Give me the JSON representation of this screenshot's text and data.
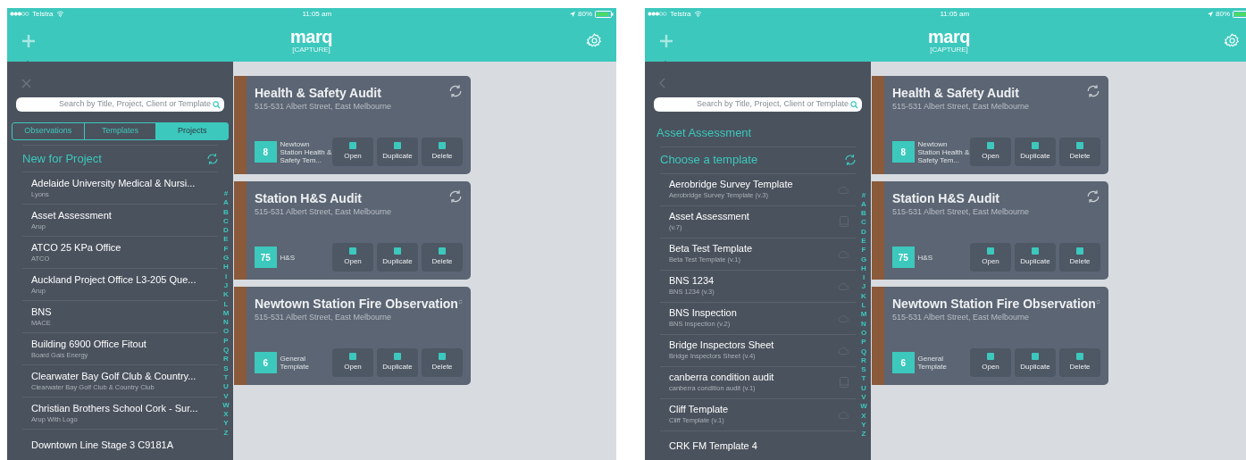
{
  "screens": [
    {
      "status_bar": {
        "carrier": "Telstra",
        "time": "11:05 am",
        "battery": "80%"
      },
      "header": {
        "logo": "marq",
        "logo_sub": "[CAPTURE]"
      },
      "panel": {
        "kind": "projects",
        "search": {
          "placeholder": "Search by Title, Project, Client or Template"
        },
        "tabs": [
          {
            "label": "Observations",
            "selected": false
          },
          {
            "label": "Templates",
            "selected": false
          },
          {
            "label": "Projects",
            "selected": true
          }
        ],
        "section": "New for Project",
        "items": [
          {
            "title": "Adelaide University Medical & Nursi...",
            "subtitle": "Lyons"
          },
          {
            "title": "Asset Assessment",
            "subtitle": "Arup"
          },
          {
            "title": "ATCO 25 KPa Office",
            "subtitle": "ATCO"
          },
          {
            "title": "Auckland Project Office L3-205 Que...",
            "subtitle": "Arup"
          },
          {
            "title": "BNS",
            "subtitle": "MACE"
          },
          {
            "title": "Building 6900 Office Fitout",
            "subtitle": "Board Gais Energy"
          },
          {
            "title": "Clearwater Bay Golf Club & Country...",
            "subtitle": "Clearwater Bay Golf Club & Country Club"
          },
          {
            "title": "Christian Brothers School Cork - Sur...",
            "subtitle": "Arup With Logo"
          },
          {
            "title": "Downtown Line Stage 3 C9181A"
          }
        ],
        "index": [
          "#",
          "A",
          "B",
          "C",
          "D",
          "E",
          "F",
          "G",
          "H",
          "I",
          "J",
          "K",
          "L",
          "M",
          "N",
          "O",
          "P",
          "Q",
          "R",
          "S",
          "T",
          "U",
          "V",
          "W",
          "X",
          "Y",
          "Z"
        ]
      },
      "cards": [
        {
          "title": "Health & Safety Audit",
          "address": "515-531 Albert Street, East Melbourne",
          "count": "8",
          "label": "Newtown Station Health & Safety Tem...",
          "buttons": [
            "Open",
            "Duplicate",
            "Delete"
          ]
        },
        {
          "title": "Station H&S Audit",
          "address": "515-531 Albert Street, East Melbourne",
          "count": "75",
          "label": "H&S",
          "buttons": [
            "Open",
            "Duplicate",
            "Delete"
          ]
        },
        {
          "title": "Newtown Station Fire Observation",
          "address": "515-531 Albert Street, East Melbourne",
          "count": "6",
          "label": "General Template",
          "buttons": [
            "Open",
            "Duplicate",
            "Delete"
          ]
        }
      ]
    },
    {
      "status_bar": {
        "carrier": "Telstra",
        "time": "11:05 am",
        "battery": "80%"
      },
      "header": {
        "logo": "marq",
        "logo_sub": "[CAPTURE]"
      },
      "panel": {
        "kind": "templates",
        "search": {
          "placeholder": "Search by Title, Project, Client or Template"
        },
        "breadcrumb": "Asset Assessment",
        "section": "Choose a template",
        "items": [
          {
            "title": "Aerobridge Survey Template",
            "subtitle": "Aerobridge Survey Template (v.3)",
            "kind": "cloud"
          },
          {
            "title": "Asset Assessment",
            "subtitle": "(v.7)",
            "kind": "device"
          },
          {
            "title": "Beta Test Template",
            "subtitle": "Beta Test Template (v.1)",
            "kind": "cloud"
          },
          {
            "title": "BNS 1234",
            "subtitle": "BNS 1234 (v.3)",
            "kind": "cloud"
          },
          {
            "title": "BNS Inspection",
            "subtitle": "BNS Inspection (v.2)",
            "kind": "cloud"
          },
          {
            "title": "Bridge Inspectors Sheet",
            "subtitle": "Bridge Inspectors Sheet (v.4)",
            "kind": "cloud"
          },
          {
            "title": "canberra condition audit",
            "subtitle": "canberra condition audit (v.1)",
            "kind": "device"
          },
          {
            "title": "Cliff Template",
            "subtitle": "Cliff Template (v.1)",
            "kind": "cloud"
          },
          {
            "title": "CRK FM Template 4"
          }
        ],
        "index": [
          "#",
          "A",
          "B",
          "C",
          "D",
          "E",
          "F",
          "G",
          "H",
          "I",
          "J",
          "K",
          "L",
          "M",
          "N",
          "O",
          "P",
          "Q",
          "R",
          "S",
          "T",
          "U",
          "V",
          "W",
          "X",
          "Y",
          "Z"
        ]
      },
      "cards": [
        {
          "title": "Health & Safety Audit",
          "address": "515-531 Albert Street, East Melbourne",
          "count": "8",
          "label": "Newtown Station Health & Safety Tem...",
          "buttons": [
            "Open",
            "Duplicate",
            "Delete"
          ]
        },
        {
          "title": "Station H&S Audit",
          "address": "515-531 Albert Street, East Melbourne",
          "count": "75",
          "label": "H&S",
          "buttons": [
            "Open",
            "Duplicate",
            "Delete"
          ]
        },
        {
          "title": "Newtown Station Fire Observation",
          "address": "515-531 Albert Street, East Melbourne",
          "count": "6",
          "label": "General Template",
          "buttons": [
            "Open",
            "Duplicate",
            "Delete"
          ]
        }
      ]
    }
  ]
}
